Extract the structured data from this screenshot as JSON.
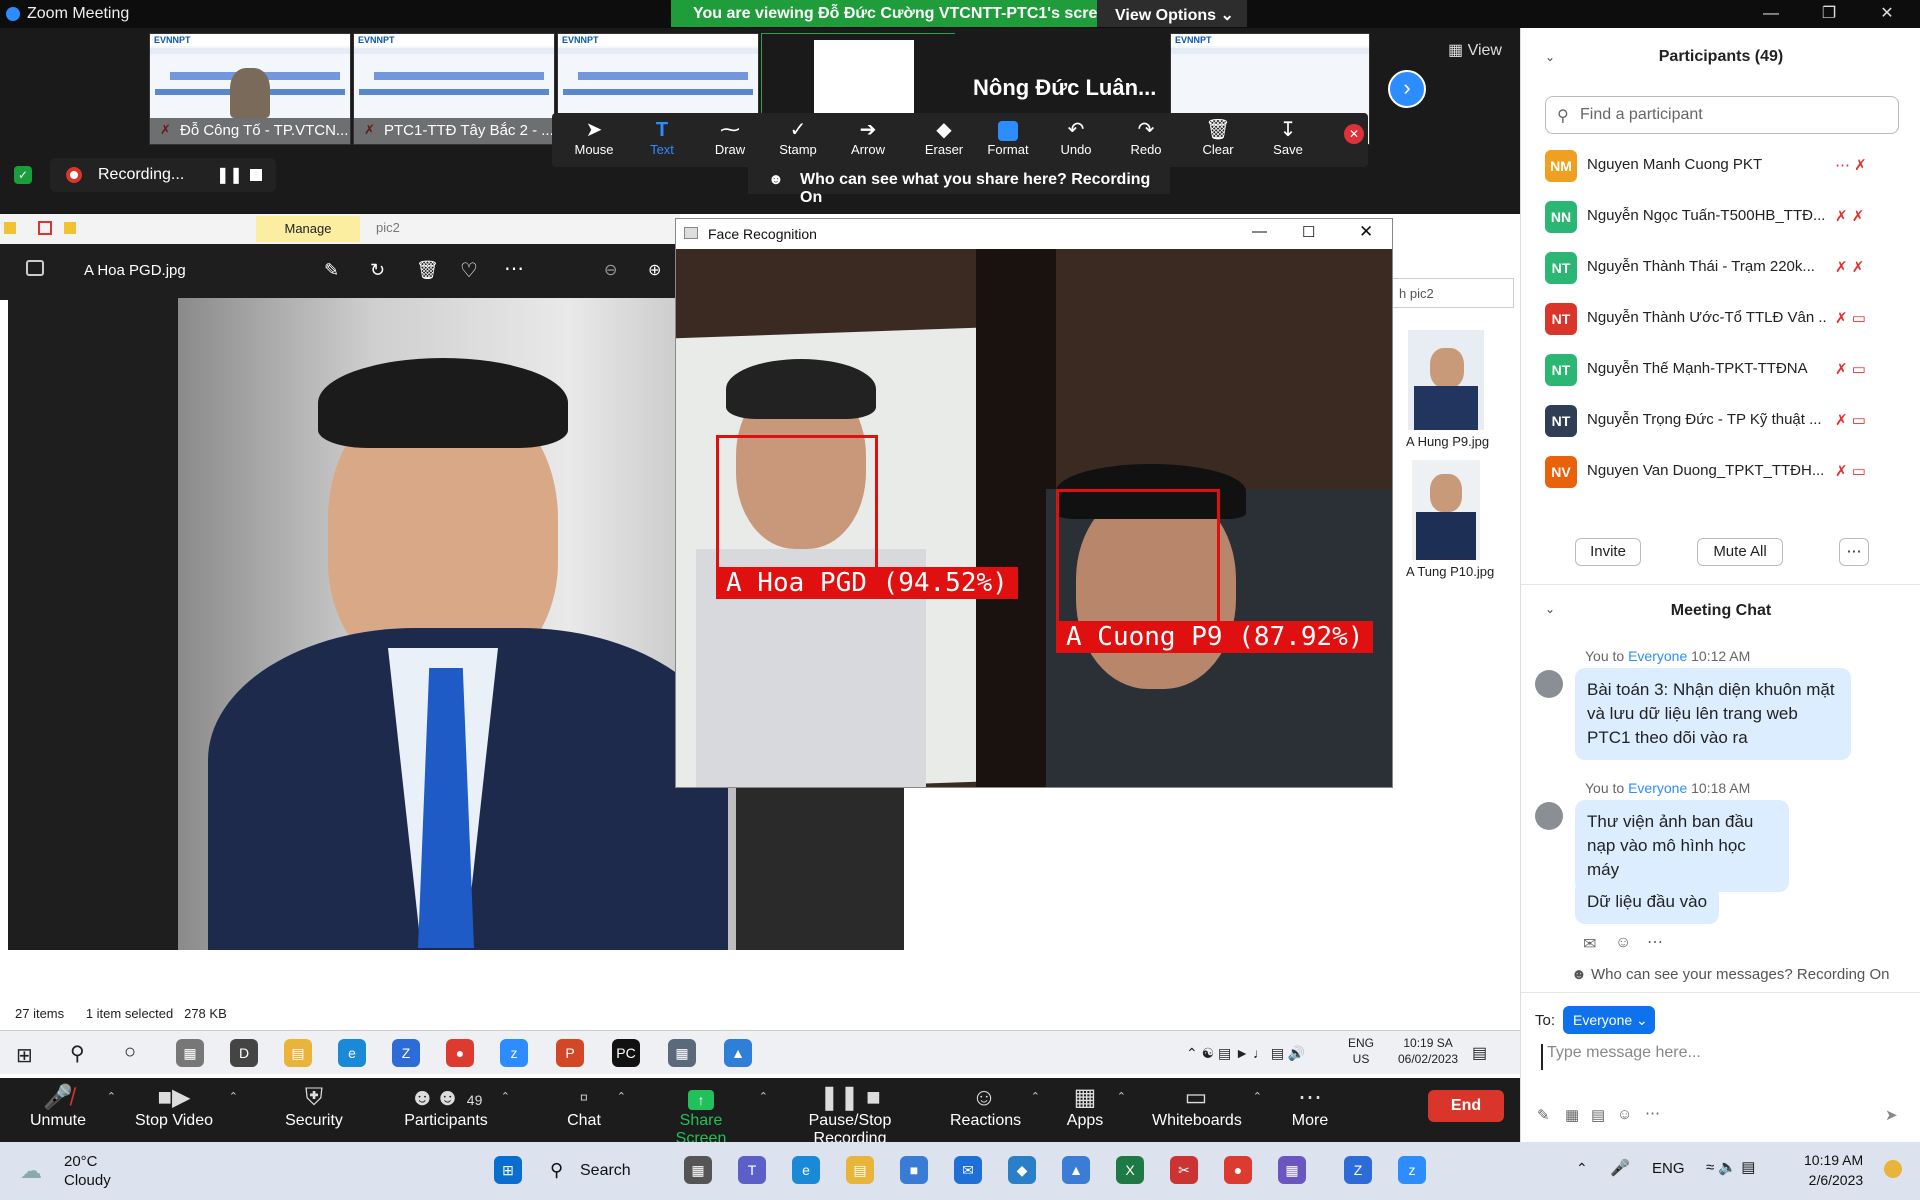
{
  "window": {
    "title": "Zoom Meeting"
  },
  "banner": {
    "message": "You are viewing Đỗ Đức Cường VTCNTT-PTC1's screen",
    "options_label": "View Options"
  },
  "thumbnails": [
    {
      "label": "Đỗ Công Tố - TP.VTCN..."
    },
    {
      "label": "PTC1-TTĐ Tây Bắc 2 - ..."
    },
    {
      "label": ""
    },
    {
      "label": ""
    }
  ],
  "active_speaker_name": "Nông Đức Luân...",
  "view_label": "View",
  "recording": {
    "label": "Recording..."
  },
  "annotate": {
    "tools": [
      "Mouse",
      "Text",
      "Draw",
      "Stamp",
      "Arrow",
      "Eraser",
      "Format",
      "Undo",
      "Redo",
      "Clear",
      "Save"
    ],
    "notice": "Who can see what you share here? Recording On"
  },
  "photos": {
    "manage_tab": "Manage",
    "pic_tab": "pic2",
    "filename": "A Hoa PGD.jpg",
    "status": {
      "items": "27 items",
      "selected": "1 item selected",
      "size": "278 KB"
    },
    "explorer_search": "h pic2",
    "files": [
      "A Hung P9.jpg",
      "A Tung P10.jpg"
    ]
  },
  "face_window": {
    "title": "Face Recognition",
    "detections": [
      {
        "name": "A Hoa PGD",
        "confidence": "(94.52%)"
      },
      {
        "name": "A Cuong P9",
        "confidence": "(87.92%)"
      }
    ]
  },
  "inner_taskbar": {
    "lang": "ENG",
    "region": "US",
    "time": "10:19 SA",
    "date": "06/02/2023"
  },
  "toolbar": {
    "unmute": "Unmute",
    "stop_video": "Stop Video",
    "security": "Security",
    "participants": "Participants",
    "participants_count": "49",
    "chat": "Chat",
    "share": "Share Screen",
    "recording": "Pause/Stop Recording",
    "reactions": "Reactions",
    "apps": "Apps",
    "whiteboards": "Whiteboards",
    "more": "More",
    "end": "End"
  },
  "participants": {
    "header": "Participants (49)",
    "search_placeholder": "Find a participant",
    "list": [
      {
        "initials": "NM",
        "name": "Nguyen Manh Cuong PKT",
        "color": "#f0a020"
      },
      {
        "initials": "NN",
        "name": "Nguyễn Ngọc Tuấn-T500HB_TTĐ...",
        "color": "#2bb673"
      },
      {
        "initials": "NT",
        "name": "Nguyễn Thành Thái - Trạm 220k...",
        "color": "#2bb673"
      },
      {
        "initials": "NT",
        "name": "Nguyễn Thành Ước-Tổ TTLĐ Vân ...",
        "color": "#d9352a"
      },
      {
        "initials": "NT",
        "name": "Nguyễn Thế Mạnh-TPKT-TTĐNA",
        "color": "#2bb673"
      },
      {
        "initials": "NT",
        "name": "Nguyễn Trọng Đức - TP Kỹ thuật ...",
        "color": "#2f3e55"
      },
      {
        "initials": "NV",
        "name": "Nguyen Van Duong_TPKT_TTĐH...",
        "color": "#e8620a"
      }
    ],
    "invite": "Invite",
    "mute_all": "Mute All"
  },
  "chat": {
    "header": "Meeting Chat",
    "messages": [
      {
        "sender": "You to ",
        "to": "Everyone",
        "time": "10:12 AM",
        "text": "Bài toán 3: Nhận diện khuôn mặt và lưu dữ liệu lên trang web PTC1 theo dõi vào ra"
      },
      {
        "sender": "You to ",
        "to": "Everyone",
        "time": "10:18 AM",
        "text": "Thư viện ảnh ban đầu nạp vào mô hình học máy"
      },
      {
        "text": "Dữ liệu đầu vào"
      }
    ],
    "notice": "Who can see your messages? Recording On",
    "to_label": "To:",
    "to_value": "Everyone",
    "input_placeholder": "Type message here..."
  },
  "os_taskbar": {
    "weather_temp": "20°C",
    "weather_desc": "Cloudy",
    "search": "Search",
    "lang": "ENG",
    "time": "10:19 AM",
    "date": "2/6/2023"
  }
}
